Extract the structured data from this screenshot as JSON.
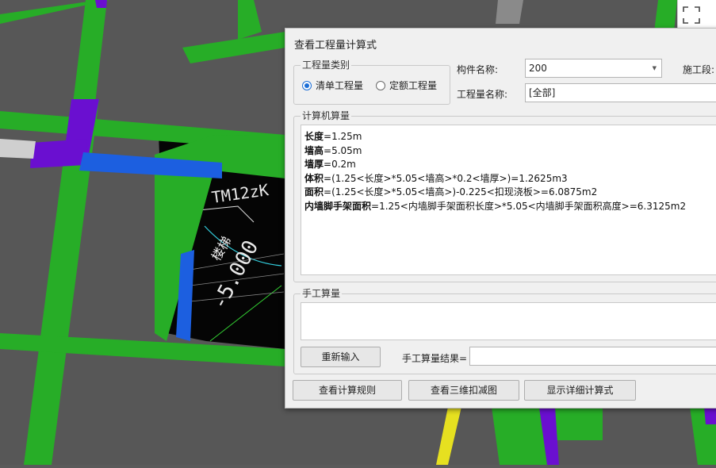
{
  "dialog": {
    "title": "查看工程量计算式",
    "category_group": {
      "legend": "工程量类别",
      "options": [
        {
          "label": "清单工程量",
          "checked": true
        },
        {
          "label": "定额工程量",
          "checked": false
        }
      ]
    },
    "component_name_label": "构件名称:",
    "component_name_value": "200",
    "quantity_name_label": "工程量名称:",
    "quantity_name_value": "[全部]",
    "construction_segment_label": "施工段:",
    "computer_calc": {
      "legend": "计算机算量",
      "lines": [
        {
          "name": "长度",
          "expr": "=1.25m"
        },
        {
          "name": "墙高",
          "expr": "=5.05m"
        },
        {
          "name": "墙厚",
          "expr": "=0.2m"
        },
        {
          "name": "体积",
          "expr": "=(1.25<长度>*5.05<墙高>*0.2<墙厚>)=1.2625m3"
        },
        {
          "name": "面积",
          "expr": "=(1.25<长度>*5.05<墙高>)-0.225<扣现浇板>=6.0875m2"
        },
        {
          "name": "内墙脚手架面积",
          "expr": "=1.25<内墙脚手架面积长度>*5.05<内墙脚手架面积高度>=6.3125m2"
        }
      ]
    },
    "manual_calc": {
      "legend": "手工算量",
      "reenter_button": "重新输入",
      "result_label": "手工算量结果=",
      "result_value": ""
    },
    "buttons": {
      "view_rules": "查看计算规则",
      "view_3d": "查看三维扣减图",
      "show_detail": "显示详细计算式"
    }
  },
  "viewport": {
    "cad_text": "TM12zK",
    "cad_dim": "-5.000",
    "cad_label": "楼梯"
  },
  "colors": {
    "wall_green": "#27ad27",
    "wall_purple": "#6a0fd0",
    "wall_blue": "#1c5fe0",
    "floor_gray": "#5a5a5a",
    "cad_background": "#000000",
    "radio_accent": "#1b6ed6"
  }
}
